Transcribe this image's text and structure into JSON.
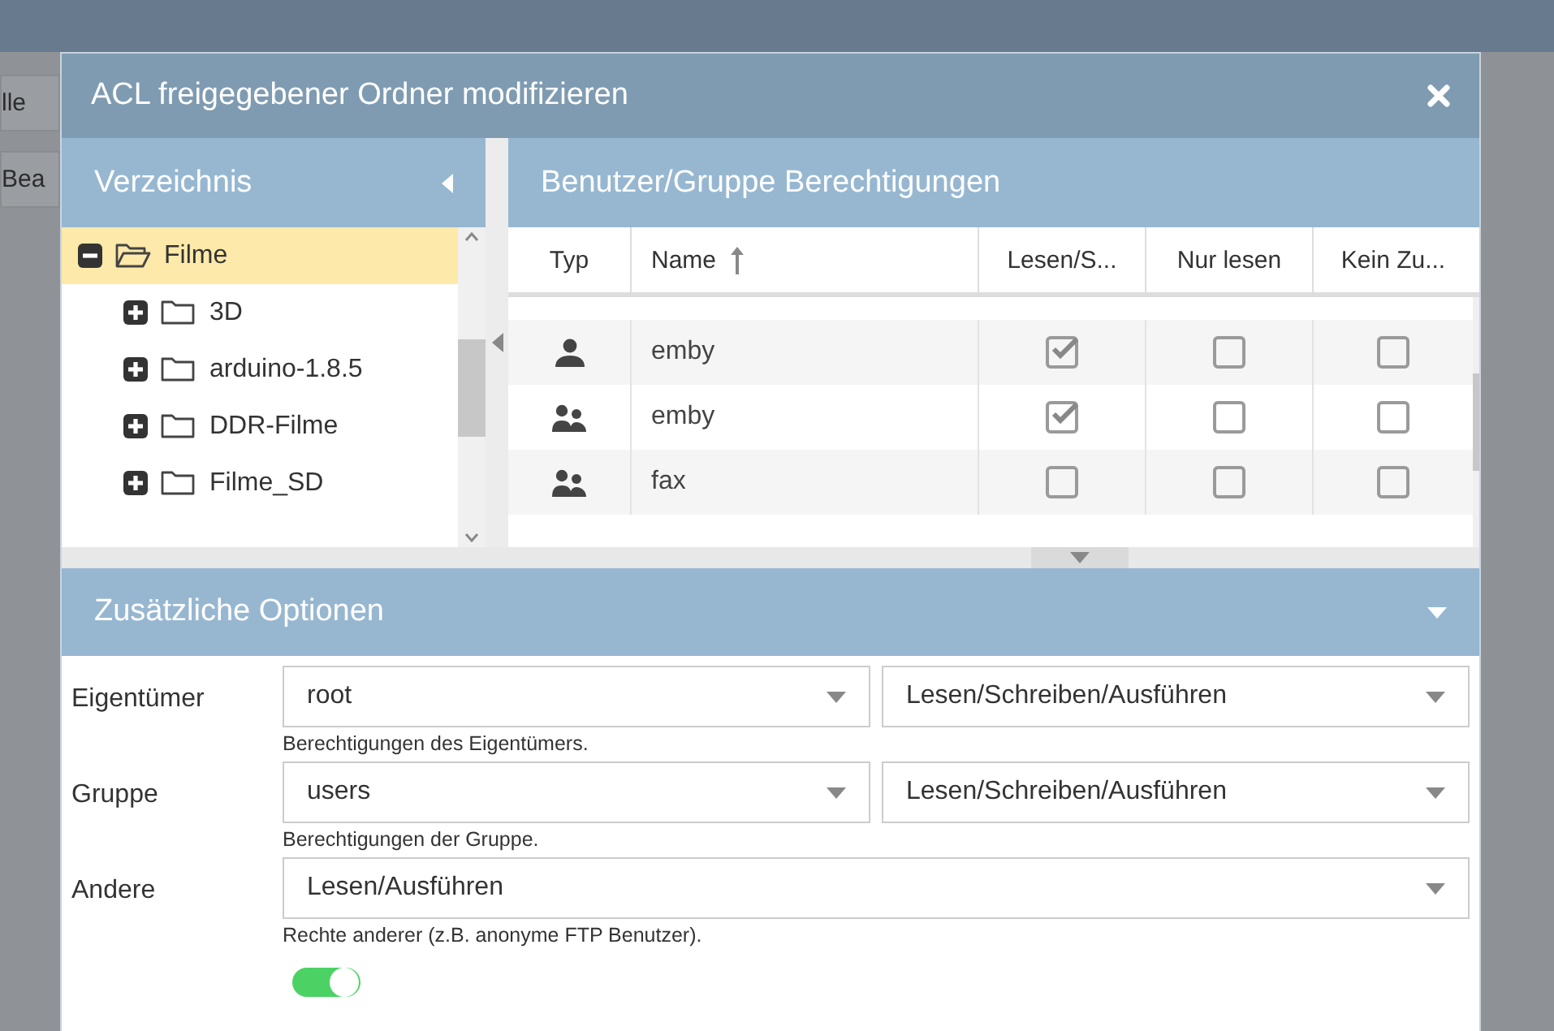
{
  "background": {
    "buttons": [
      "lle",
      "Bea"
    ]
  },
  "dialog": {
    "title": "ACL freigegebener Ordner modifizieren"
  },
  "directory": {
    "title": "Verzeichnis",
    "items": [
      {
        "label": "Filme",
        "expanded": true,
        "selected": true,
        "children": [
          {
            "label": "3D",
            "expanded": false,
            "selected": false
          },
          {
            "label": "arduino-1.8.5",
            "expanded": false,
            "selected": false
          },
          {
            "label": "DDR-Filme",
            "expanded": false,
            "selected": false
          },
          {
            "label": "Filme_SD",
            "expanded": false,
            "selected": false
          }
        ]
      }
    ]
  },
  "permissions": {
    "title": "Benutzer/Gruppe Berechtigungen",
    "columns": [
      "Typ",
      "Name",
      "Lesen/S...",
      "Nur lesen",
      "Kein Zu..."
    ],
    "rows": [
      {
        "kind": "user",
        "name": "emby",
        "read_write": true,
        "read_only": false,
        "no_access": false
      },
      {
        "kind": "group",
        "name": "emby",
        "read_write": true,
        "read_only": false,
        "no_access": false
      },
      {
        "kind": "group",
        "name": "fax",
        "read_write": false,
        "read_only": false,
        "no_access": false
      }
    ]
  },
  "options": {
    "title": "Zusätzliche Optionen",
    "expanded": true,
    "fields": [
      {
        "label": "Eigentümer",
        "selects": [
          "root",
          "Lesen/Schreiben/Ausführen"
        ],
        "hint": "Berechtigungen des Eigentümers."
      },
      {
        "label": "Gruppe",
        "selects": [
          "users",
          "Lesen/Schreiben/Ausführen"
        ],
        "hint": "Berechtigungen der Gruppe."
      },
      {
        "label": "Andere",
        "selects": [
          "Lesen/Ausführen"
        ],
        "hint": "Rechte anderer (z.B. anonyme FTP Benutzer)."
      }
    ],
    "replace_toggle": {
      "on": true
    }
  }
}
